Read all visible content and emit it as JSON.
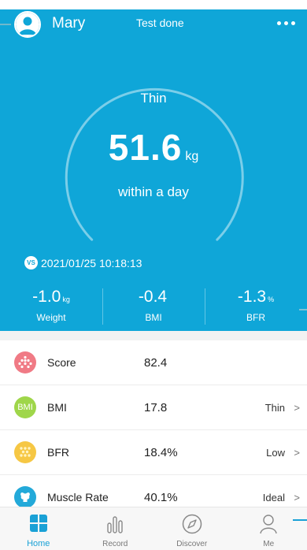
{
  "header": {
    "user_name": "Mary",
    "status": "Test done"
  },
  "gauge": {
    "status_label": "Thin",
    "weight_value": "51.6",
    "weight_unit": "kg",
    "period": "within a day"
  },
  "comparison": {
    "badge": "VS",
    "date": "2021/01/25 10:18:13",
    "items": [
      {
        "value": "-1.0",
        "unit": "kg",
        "label": "Weight"
      },
      {
        "value": "-0.4",
        "unit": "",
        "label": "BMI"
      },
      {
        "value": "-1.3",
        "unit": "%",
        "label": "BFR"
      }
    ]
  },
  "metrics": [
    {
      "name": "Score",
      "value": "82.4",
      "level": "",
      "arrow": "",
      "icon": "score-icon",
      "color": "#f07a85"
    },
    {
      "name": "BMI",
      "value": "17.8",
      "level": "Thin",
      "arrow": ">",
      "icon": "bmi-icon",
      "icon_text": "BMI",
      "color": "#9fd64a"
    },
    {
      "name": "BFR",
      "value": "18.4%",
      "level": "Low",
      "arrow": ">",
      "icon": "bfr-icon",
      "color": "#f6c744"
    },
    {
      "name": "Muscle Rate",
      "value": "40.1%",
      "level": "Ideal",
      "arrow": ">",
      "icon": "muscle-icon",
      "color": "#23a9d9"
    }
  ],
  "nav": {
    "home": "Home",
    "record": "Record",
    "discover": "Discover",
    "me": "Me"
  },
  "colors": {
    "primary": "#0fa6d8",
    "accent": "#1aa1d6"
  }
}
